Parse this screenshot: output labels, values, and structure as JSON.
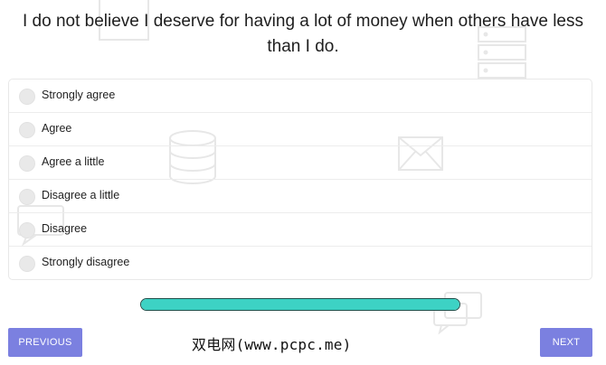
{
  "question": {
    "text": "I do not believe I deserve for having a lot of money when others have less than I do."
  },
  "options": [
    {
      "label": "Strongly agree"
    },
    {
      "label": "Agree"
    },
    {
      "label": "Agree a little"
    },
    {
      "label": "Disagree a little"
    },
    {
      "label": "Disagree"
    },
    {
      "label": "Strongly disagree"
    }
  ],
  "progress": {
    "fraction": 1.0
  },
  "navigation": {
    "previous_label": "PREVIOUS",
    "next_label": "NEXT"
  },
  "watermark": {
    "text": "双电网(www.pcpc.me)"
  },
  "colors": {
    "button": "#7b80e0",
    "progress_fill": "#3dd2c4",
    "progress_border": "#1f4f4a"
  },
  "background_icons": [
    "document-icon",
    "server-icon",
    "database-icon",
    "envelope-icon",
    "chat-bubble-icon",
    "comment-icon"
  ]
}
